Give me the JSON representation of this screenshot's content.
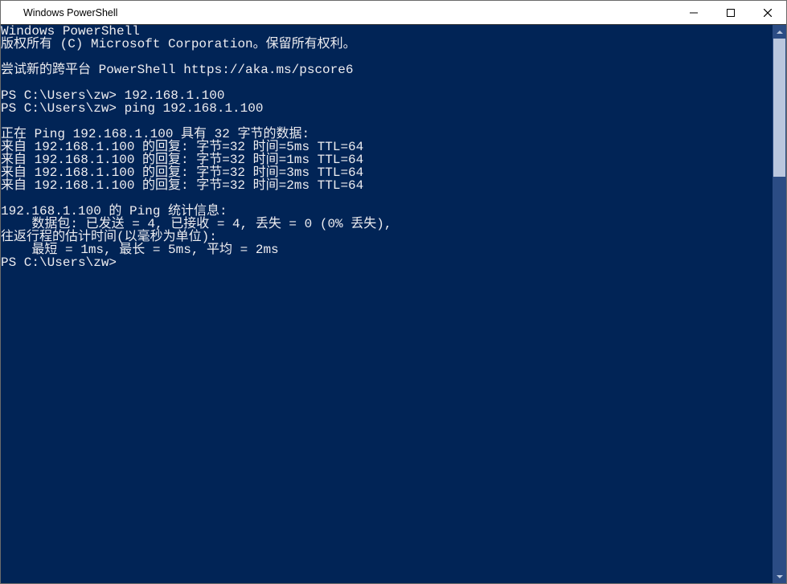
{
  "window": {
    "title": "Windows PowerShell"
  },
  "terminal": {
    "lines": [
      "Windows PowerShell",
      "版权所有 (C) Microsoft Corporation。保留所有权利。",
      "",
      "尝试新的跨平台 PowerShell https://aka.ms/pscore6",
      "",
      "PS C:\\Users\\zw> 192.168.1.100",
      "PS C:\\Users\\zw> ping 192.168.1.100",
      "",
      "正在 Ping 192.168.1.100 具有 32 字节的数据:",
      "来自 192.168.1.100 的回复: 字节=32 时间=5ms TTL=64",
      "来自 192.168.1.100 的回复: 字节=32 时间=1ms TTL=64",
      "来自 192.168.1.100 的回复: 字节=32 时间=3ms TTL=64",
      "来自 192.168.1.100 的回复: 字节=32 时间=2ms TTL=64",
      "",
      "192.168.1.100 的 Ping 统计信息:",
      "    数据包: 已发送 = 4, 已接收 = 4, 丢失 = 0 (0% 丢失),",
      "往返行程的估计时间(以毫秒为单位):",
      "    最短 = 1ms, 最长 = 5ms, 平均 = 2ms",
      "PS C:\\Users\\zw>"
    ]
  }
}
